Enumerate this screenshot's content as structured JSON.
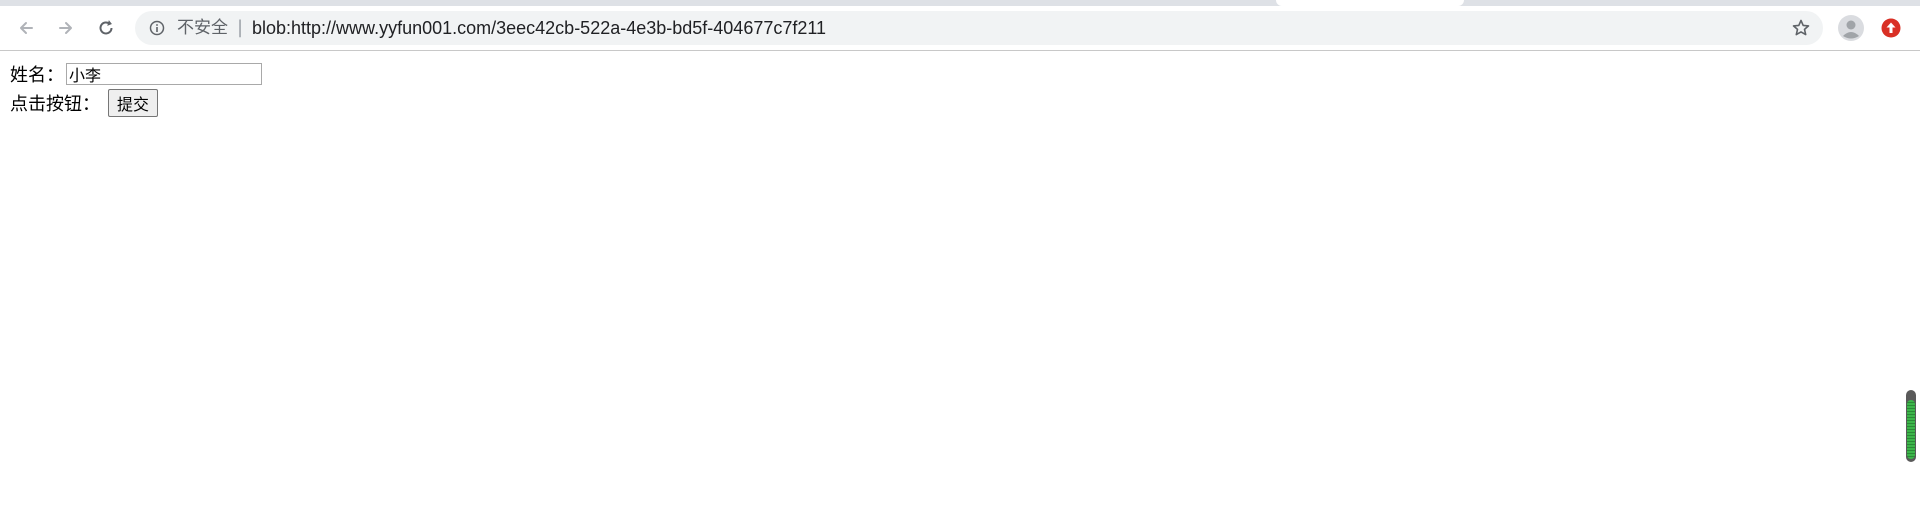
{
  "browser": {
    "security_label": "不安全",
    "separator": "|",
    "url": "blob:http://www.yyfun001.com/3eec42cb-522a-4e3b-bd5f-404677c7f211",
    "icons": {
      "back": "back-arrow-icon",
      "forward": "forward-arrow-icon",
      "reload": "reload-icon",
      "info": "info-icon",
      "bookmark": "star-icon",
      "profile": "profile-icon",
      "update": "update-icon"
    },
    "colors": {
      "update_badge": "#d93025",
      "omnibox_bg": "#f1f3f4"
    }
  },
  "form": {
    "name_label": "姓名：",
    "name_value": "小李",
    "submit_label": "点击按钮：",
    "submit_button": "提交"
  },
  "side_widget": {
    "level": 0.9,
    "color": "#3cb54a"
  }
}
